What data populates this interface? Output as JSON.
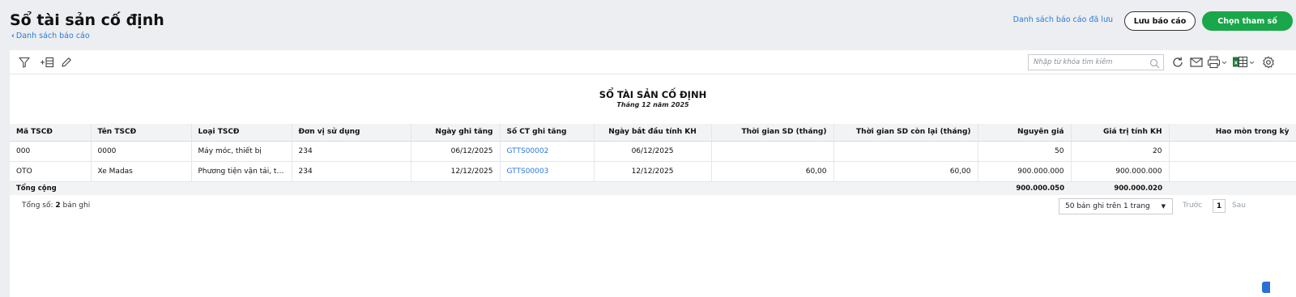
{
  "header": {
    "title": "Sổ tài sản cố định",
    "back_label": "Danh sách báo cáo",
    "saved_reports_label": "Danh sách báo cáo đã lưu",
    "save_report_label": "Lưu báo cáo",
    "choose_params_label": "Chọn tham số"
  },
  "toolbar": {
    "search_placeholder": "Nhập từ khóa tìm kiếm",
    "left_icons": [
      "filter-icon",
      "add-row-icon",
      "edit-icon"
    ],
    "right_icons": [
      "refresh-icon",
      "email-icon",
      "print-icon",
      "excel-export-icon",
      "settings-icon"
    ]
  },
  "report": {
    "title": "SỔ TÀI SẢN CỐ ĐỊNH",
    "subtitle": "Tháng 12 năm 2025"
  },
  "table": {
    "columns": [
      "Mã TSCĐ",
      "Tên TSCĐ",
      "Loại TSCĐ",
      "Đơn vị sử dụng",
      "Ngày ghi tăng",
      "Số CT ghi tăng",
      "Ngày bắt đầu tính KH",
      "Thời gian SD (tháng)",
      "Thời gian SD còn lại (tháng)",
      "Nguyên giá",
      "Giá trị tính KH",
      "Hao mòn trong kỳ"
    ],
    "rows": [
      [
        "000",
        "0000",
        "Máy móc, thiết bị",
        "234",
        "06/12/2025",
        "GTTS00002",
        "06/12/2025",
        "",
        "",
        "50",
        "20",
        ""
      ],
      [
        "OTO",
        "Xe Madas",
        "Phương tiện vận tải, truyền dẫn",
        "234",
        "12/12/2025",
        "GTTS00003",
        "12/12/2025",
        "60,00",
        "60,00",
        "900.000.000",
        "900.000.000",
        ""
      ]
    ],
    "total": {
      "label": "Tổng cộng",
      "original_cost": "900.000.050",
      "depreciable_value": "900.000.020"
    }
  },
  "footer": {
    "count_prefix": "Tổng số: ",
    "count_value": "2",
    "count_suffix": " bản ghi",
    "page_size_label": "50 bản ghi trên 1 trang",
    "prev_label": "Trước",
    "current_page": "1",
    "next_label": "Sau"
  },
  "colors": {
    "accent_green": "#1aa64a",
    "link_blue": "#2b7ad6",
    "page_bg": "#eceef1"
  }
}
